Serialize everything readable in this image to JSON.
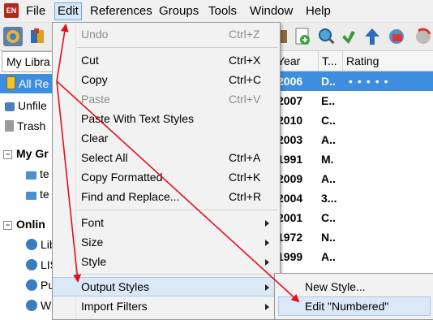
{
  "menubar": {
    "items": [
      "File",
      "Edit",
      "References",
      "Groups",
      "Tools",
      "Window",
      "Help"
    ]
  },
  "library": {
    "dropdown_label": "My Libra"
  },
  "sidebar": {
    "all_refs": "All Re",
    "unfiled": "Unfile",
    "trash": "Trash",
    "my_groups": "My Gr",
    "group1": "te",
    "group2": "te",
    "online": "Onlin",
    "online1": "Lib",
    "online2": "LIS",
    "online3": "Pu",
    "online4": "W"
  },
  "table": {
    "headers": [
      "Year",
      "T...",
      "Rating"
    ],
    "rows": [
      {
        "year": "2006",
        "type": "D..",
        "rating": "•••••"
      },
      {
        "year": "2007",
        "type": "E..",
        "rating": ""
      },
      {
        "year": "2010",
        "type": "C..",
        "rating": ""
      },
      {
        "year": "2003",
        "type": "A..",
        "rating": ""
      },
      {
        "year": "1991",
        "type": "M.",
        "rating": ""
      },
      {
        "year": "2009",
        "type": "A..",
        "rating": ""
      },
      {
        "year": "2004",
        "type": "3...",
        "rating": ""
      },
      {
        "year": "2001",
        "type": "C..",
        "rating": ""
      },
      {
        "year": "1972",
        "type": "N..",
        "rating": ""
      },
      {
        "year": "1999",
        "type": "A..",
        "rating": ""
      }
    ]
  },
  "edit_menu": {
    "undo": {
      "label": "Undo",
      "shortcut": "Ctrl+Z"
    },
    "cut": {
      "label": "Cut",
      "shortcut": "Ctrl+X"
    },
    "copy": {
      "label": "Copy",
      "shortcut": "Ctrl+C"
    },
    "paste": {
      "label": "Paste",
      "shortcut": "Ctrl+V"
    },
    "paste_styles": {
      "label": "Paste With Text Styles"
    },
    "clear": {
      "label": "Clear"
    },
    "select_all": {
      "label": "Select All",
      "shortcut": "Ctrl+A"
    },
    "copy_formatted": {
      "label": "Copy Formatted",
      "shortcut": "Ctrl+K"
    },
    "find_replace": {
      "label": "Find and Replace...",
      "shortcut": "Ctrl+R"
    },
    "font": {
      "label": "Font"
    },
    "size": {
      "label": "Size"
    },
    "style": {
      "label": "Style"
    },
    "output_styles": {
      "label": "Output Styles"
    },
    "import_filters": {
      "label": "Import Filters"
    }
  },
  "submenu": {
    "new_style": "New Style...",
    "edit_numbered": "Edit \"Numbered\""
  },
  "colors": {
    "selection": "#3d8ee0",
    "menu_highlight": "#dbe8f6",
    "annotation_arrow": "#e0101a"
  }
}
